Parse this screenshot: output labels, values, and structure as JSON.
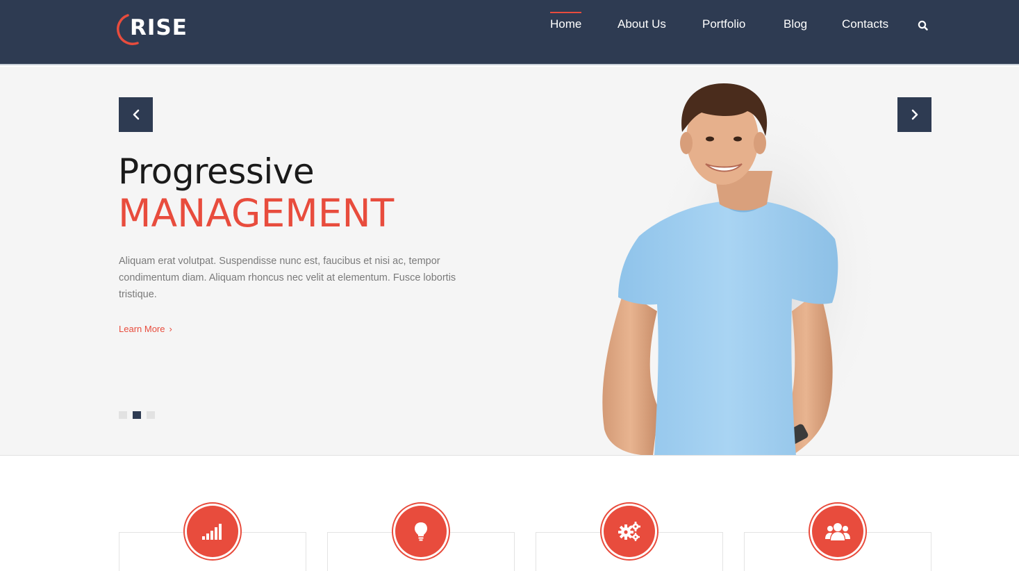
{
  "brand": {
    "logo_text": "RISE",
    "accent_color": "#e84c3d",
    "dark_color": "#2e3b52"
  },
  "nav": {
    "items": [
      {
        "label": "Home",
        "active": true
      },
      {
        "label": "About Us",
        "active": false
      },
      {
        "label": "Portfolio",
        "active": false
      },
      {
        "label": "Blog",
        "active": false
      },
      {
        "label": "Contacts",
        "active": false
      }
    ],
    "search_icon": "search-icon"
  },
  "hero": {
    "title": "Progressive",
    "subtitle": "MANAGEMENT",
    "description": "Aliquam erat volutpat. Suspendisse nunc est, faucibus et nisi ac, tempor condimentum diam. Aliquam rhoncus nec velit at elementum. Fusce lobortis tristique.",
    "learn_more_label": "Learn More",
    "prev_icon": "chevron-left-icon",
    "next_icon": "chevron-right-icon",
    "slides_total": 3,
    "active_slide": 2
  },
  "features": [
    {
      "icon": "signal-bars-icon"
    },
    {
      "icon": "lightbulb-icon"
    },
    {
      "icon": "gears-icon"
    },
    {
      "icon": "users-icon"
    }
  ]
}
